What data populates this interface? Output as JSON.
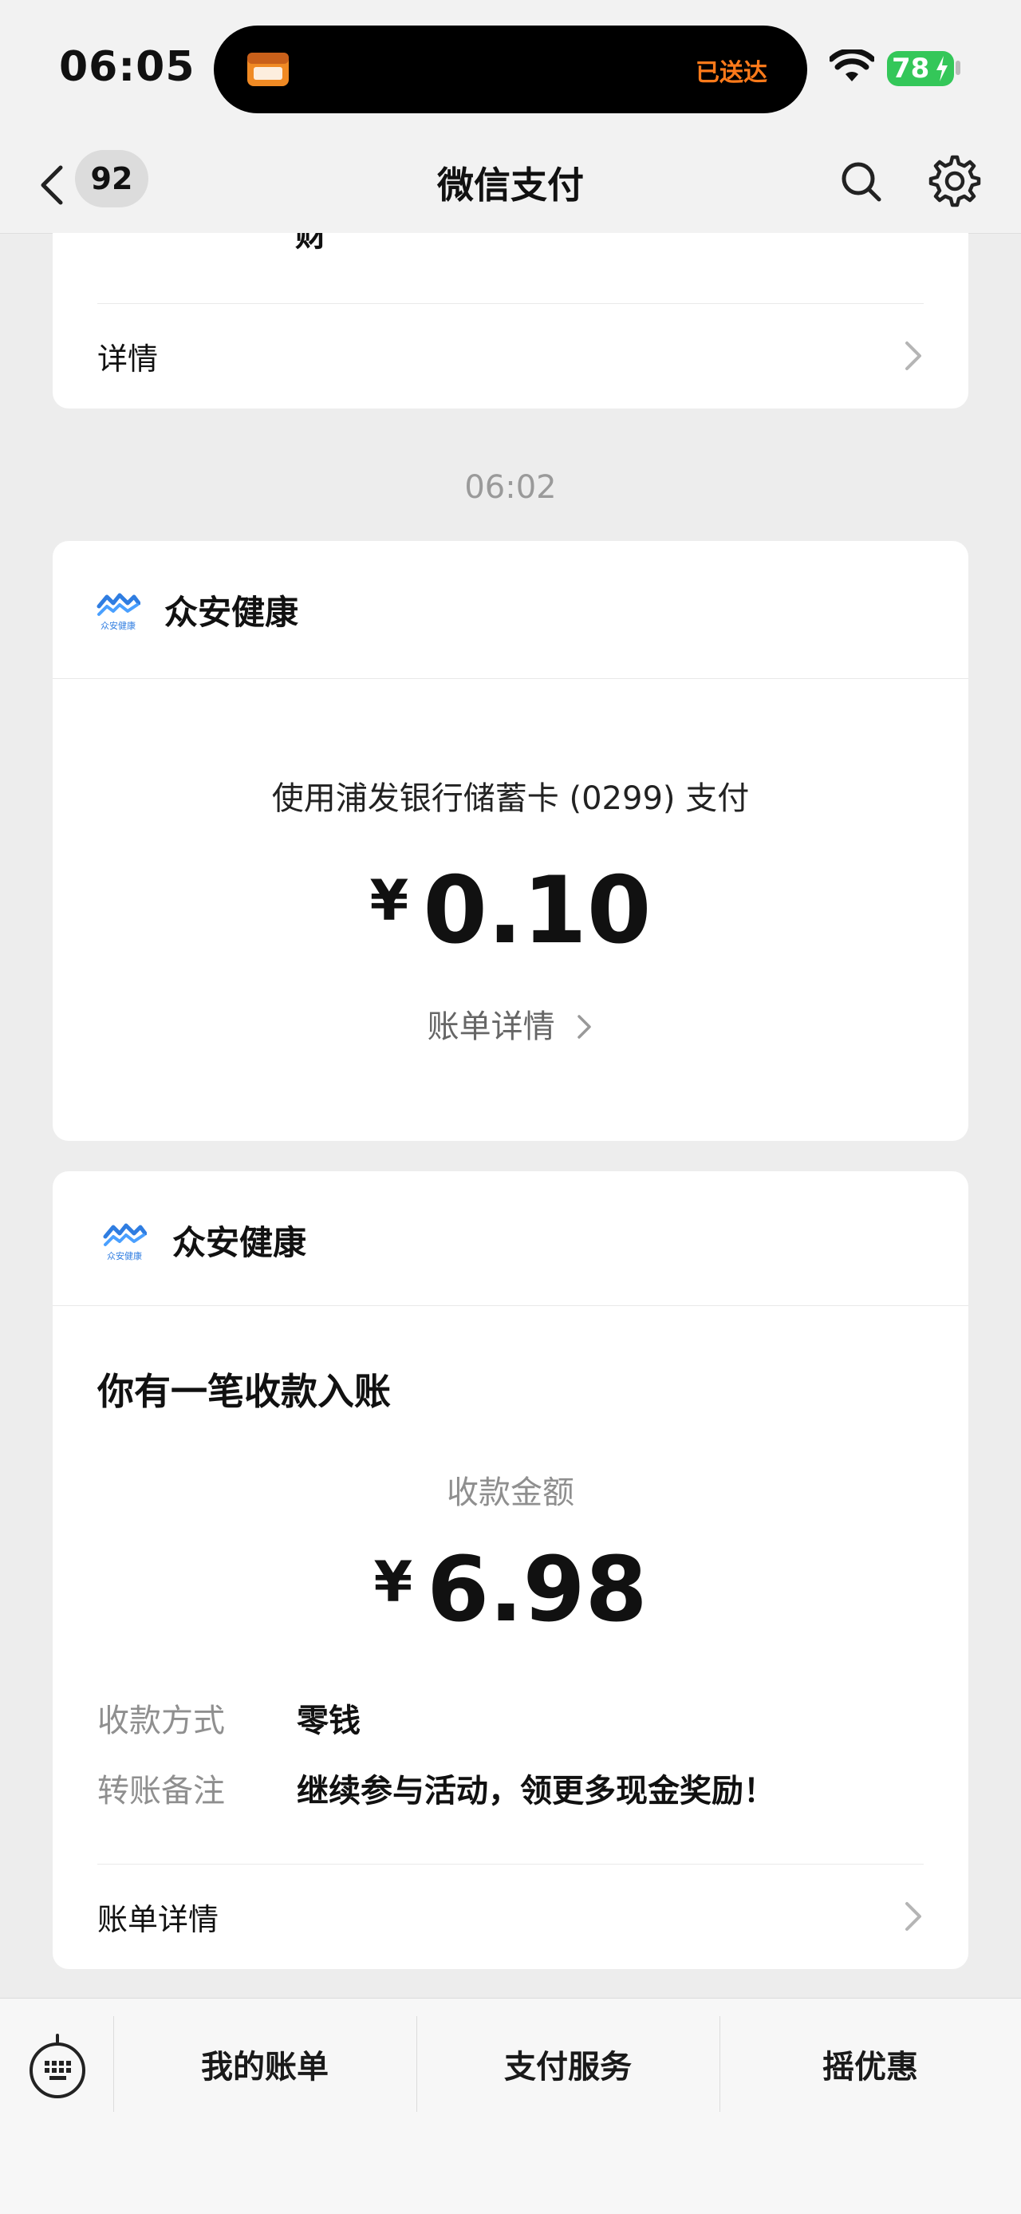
{
  "status_bar": {
    "time": "06:05",
    "island_status": "已送达",
    "battery": "78"
  },
  "nav": {
    "badge_count": "92",
    "title": "微信支付"
  },
  "prev_card": {
    "cut_text": "财",
    "detail_label": "详情"
  },
  "timestamp": "06:02",
  "payment_card": {
    "merchant": "众安健康",
    "logo_caption": "众安健康",
    "description": "使用浦发银行储蓄卡 (0299) 支付",
    "currency": "¥",
    "amount": "0.10",
    "bill_link": "账单详情"
  },
  "receipt_card": {
    "merchant": "众安健康",
    "logo_caption": "众安健康",
    "heading": "你有一笔收款入账",
    "amount_label": "收款金额",
    "currency": "¥",
    "amount": "6.98",
    "method_label": "收款方式",
    "method_value": "零钱",
    "note_label": "转账备注",
    "note_value": "继续参与活动，领更多现金奖励！",
    "detail_label": "账单详情"
  },
  "bottom_menu": {
    "items": [
      "我的账单",
      "支付服务",
      "摇优惠"
    ]
  },
  "colors": {
    "accent_orange": "#ff7a1a",
    "battery_green": "#34c759",
    "logo_blue": "#2f7de1"
  },
  "icons": [
    "back-icon",
    "search-icon",
    "gear-icon",
    "chevron-right-icon",
    "keyboard-icon",
    "wifi-icon",
    "battery-icon"
  ]
}
